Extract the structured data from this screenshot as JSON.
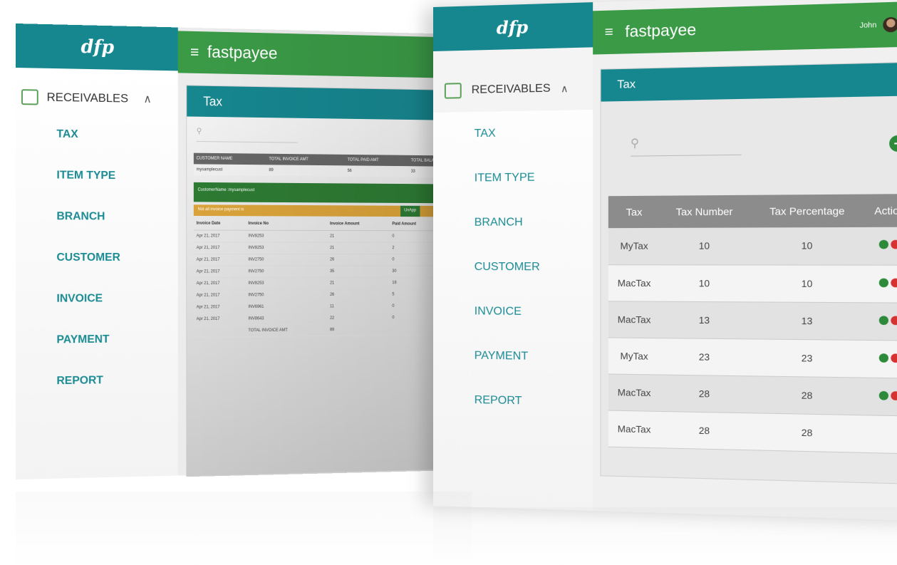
{
  "brand": {
    "name": "fastpayee",
    "logo_text": "dfp"
  },
  "back_screen": {
    "header": {
      "app_name": "fastpayee"
    },
    "sidebar": {
      "section": "RECEIVABLES",
      "items": [
        {
          "label": "TAX"
        },
        {
          "label": "ITEM TYPE"
        },
        {
          "label": "BRANCH"
        },
        {
          "label": "CUSTOMER"
        },
        {
          "label": "INVOICE"
        },
        {
          "label": "PAYMENT"
        },
        {
          "label": "REPORT"
        }
      ]
    },
    "main": {
      "title": "Tax",
      "summary_table": {
        "headers": [
          "CUSTOMER NAME",
          "TOTAL INVOICE AMT",
          "TOTAL PAID AMT",
          "TOTAL BALANCE"
        ],
        "rows": [
          [
            "mysamplecust",
            "89",
            "56",
            "33"
          ]
        ]
      },
      "customer_banner": "CustomerName :mysamplecust",
      "warning_banner": "Not all invoice payment is",
      "unapproved_label": "UnApp",
      "invoice_table": {
        "headers": [
          "Invoice Date",
          "Invoice No",
          "Invoice Amount",
          "Paid Amount",
          "Bal Am"
        ],
        "rows": [
          [
            "Apr 21, 2017",
            "INV8253",
            "21",
            "0",
            "21"
          ],
          [
            "Apr 21, 2017",
            "INV8253",
            "21",
            "2",
            "19"
          ],
          [
            "Apr 21, 2017",
            "INV2750",
            "26",
            "0",
            "26"
          ],
          [
            "Apr 21, 2017",
            "INV2750",
            "35",
            "30",
            "5"
          ],
          [
            "Apr 21, 2017",
            "INV8253",
            "21",
            "19",
            "2"
          ],
          [
            "Apr 21, 2017",
            "INV2750",
            "26",
            "5",
            "30"
          ],
          [
            "Apr 21, 2017",
            "INV6961",
            "11",
            "0",
            "11"
          ],
          [
            "Apr 21, 2017",
            "INV8643",
            "22",
            "0",
            "22"
          ]
        ],
        "total_label": "TOTAL INVOICE AMT",
        "total_value": "89"
      }
    }
  },
  "front_screen": {
    "header": {
      "app_name": "fastpayee",
      "user_name": "John"
    },
    "sidebar": {
      "section": "RECEIVABLES",
      "items": [
        {
          "label": "TAX"
        },
        {
          "label": "ITEM TYPE"
        },
        {
          "label": "BRANCH"
        },
        {
          "label": "CUSTOMER"
        },
        {
          "label": "INVOICE"
        },
        {
          "label": "PAYMENT"
        },
        {
          "label": "REPORT"
        }
      ]
    },
    "main": {
      "title": "Tax",
      "table": {
        "headers": [
          "Tax",
          "Tax Number",
          "Tax Percentage",
          "Action"
        ],
        "rows": [
          {
            "tax": "MyTax",
            "number": "10",
            "percentage": "10"
          },
          {
            "tax": "MacTax",
            "number": "10",
            "percentage": "10"
          },
          {
            "tax": "MacTax",
            "number": "13",
            "percentage": "13"
          },
          {
            "tax": "MyTax",
            "number": "23",
            "percentage": "23"
          },
          {
            "tax": "MacTax",
            "number": "28",
            "percentage": "28"
          },
          {
            "tax": "MacTax",
            "number": "28",
            "percentage": "28"
          }
        ]
      }
    }
  },
  "colors": {
    "teal": "#16868f",
    "green": "#3a9a46",
    "edit": "#2d8a3a",
    "delete": "#d63232"
  },
  "icons": {
    "menu": "hamburger-icon",
    "search": "search-icon",
    "add": "plus-circle-icon",
    "power": "power-icon",
    "receivables": "receivables-icon",
    "chevron": "chevron-up-icon"
  }
}
